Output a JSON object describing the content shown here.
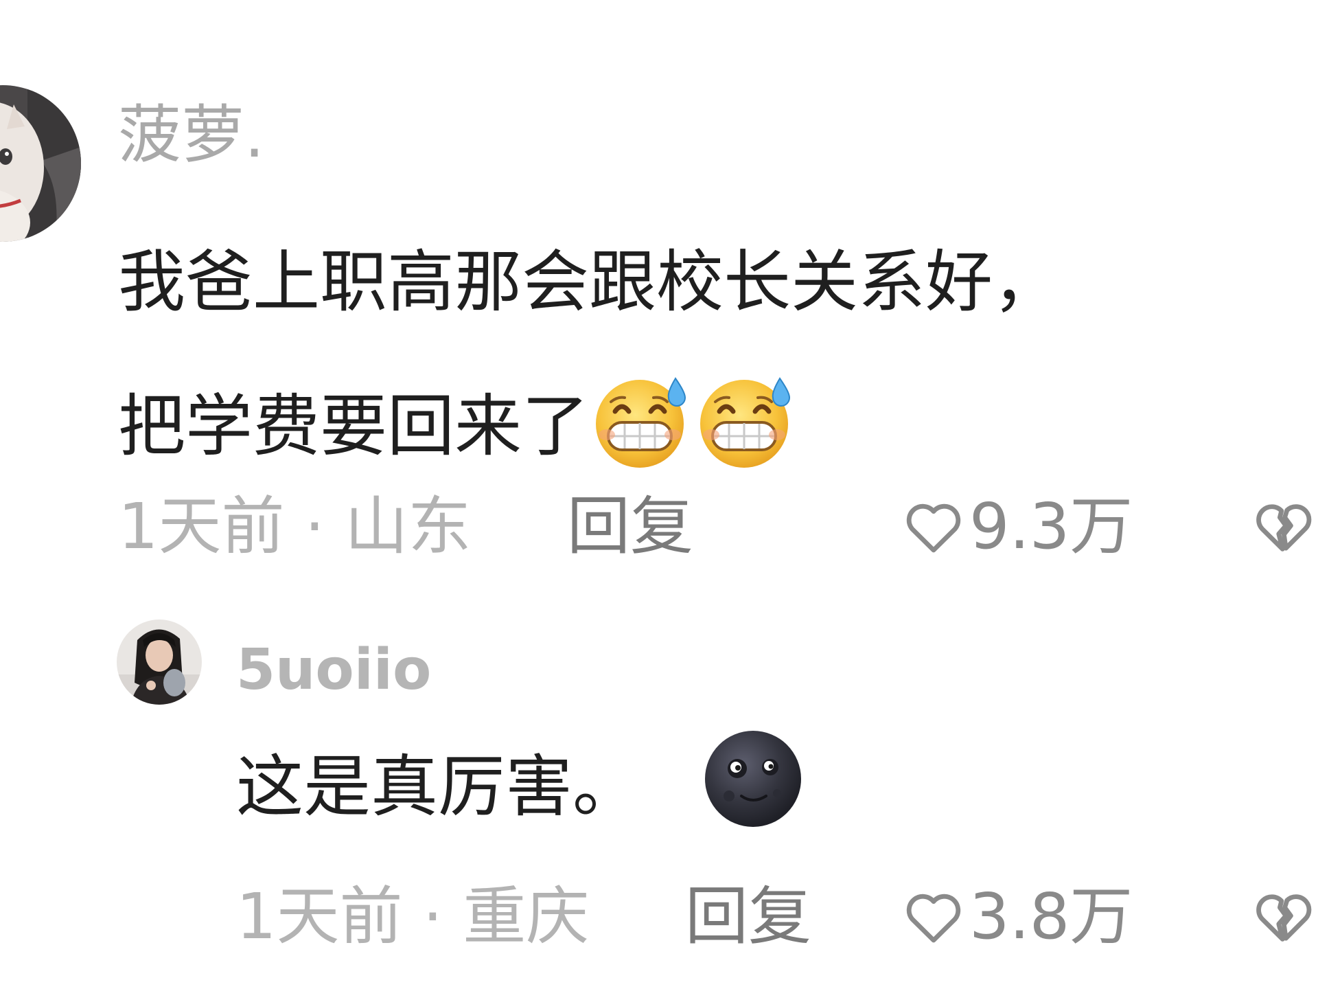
{
  "comments": [
    {
      "username": "菠萝.",
      "avatar": "cat-avatar",
      "body_line1": "我爸上职高那会跟校长关系好，",
      "body_line2": "把学费要回来了",
      "emojis": [
        "grinning-sweat-emoji",
        "grinning-sweat-emoji"
      ],
      "time_location": "1天前 · 山东",
      "reply_label": "回复",
      "like_count": "9.3万",
      "like_icon": "heart-outline-icon",
      "dislike_icon": "broken-heart-icon"
    },
    {
      "username": "5uoiio",
      "avatar": "girl-photo-avatar",
      "body": "这是真厉害。",
      "emojis": [
        "new-moon-face-emoji"
      ],
      "time_location": "1天前 · 重庆",
      "reply_label": "回复",
      "like_count": "3.8万",
      "like_icon": "heart-outline-icon",
      "dislike_icon": "broken-heart-icon"
    }
  ],
  "colors": {
    "username": "#a9a9a9",
    "body_text": "#1f1f1f",
    "meta_text": "#b3b3b3",
    "reply_text": "#7a7a7a",
    "icon_stroke": "#8a8a8a",
    "background": "#ffffff"
  }
}
